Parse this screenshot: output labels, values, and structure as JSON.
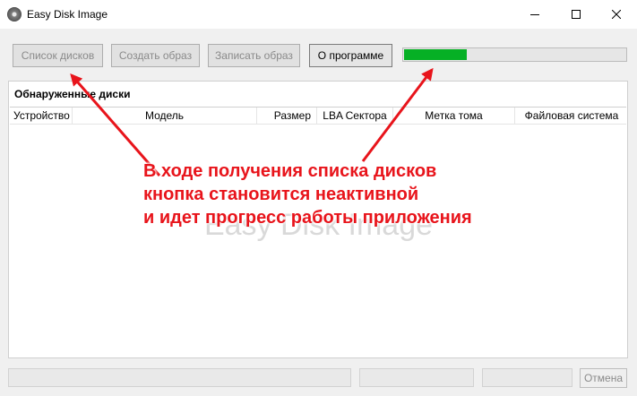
{
  "window": {
    "title": "Easy Disk Image"
  },
  "toolbar": {
    "list_disks": "Список дисков",
    "create_image": "Создать образ",
    "write_image": "Записать образ",
    "about": "О программе",
    "progress_fraction": 0.28
  },
  "group": {
    "title": "Обнаруженные диски",
    "columns": [
      "Устройство",
      "Модель",
      "Размер",
      "LBA Сектора",
      "Метка тома",
      "Файловая система"
    ],
    "watermark": "Easy Disk Image"
  },
  "status": {
    "cancel_label": "Отмена"
  },
  "annotation": {
    "lines": [
      "В ходе получения списка дисков",
      "кнопка становится неактивной",
      "и идет прогресс работы приложения"
    ],
    "color": "#e8141b"
  },
  "colors": {
    "progress": "#06b025",
    "accent": "#0078d7"
  }
}
